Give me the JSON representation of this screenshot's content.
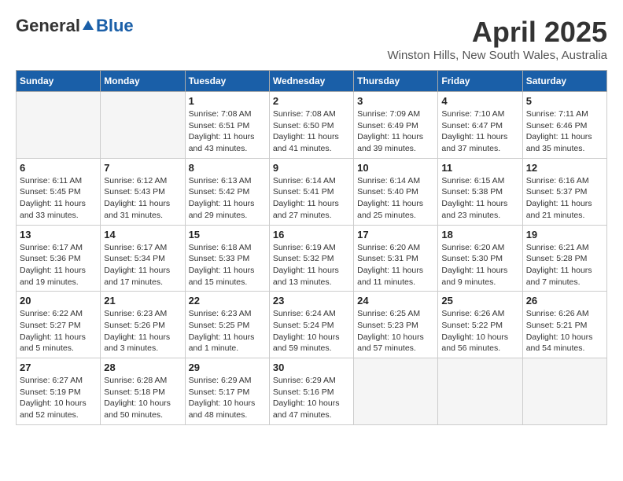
{
  "logo": {
    "general": "General",
    "blue": "Blue"
  },
  "title": "April 2025",
  "subtitle": "Winston Hills, New South Wales, Australia",
  "days_of_week": [
    "Sunday",
    "Monday",
    "Tuesday",
    "Wednesday",
    "Thursday",
    "Friday",
    "Saturday"
  ],
  "weeks": [
    [
      {
        "day": "",
        "info": ""
      },
      {
        "day": "",
        "info": ""
      },
      {
        "day": "1",
        "sunrise": "Sunrise: 7:08 AM",
        "sunset": "Sunset: 6:51 PM",
        "daylight": "Daylight: 11 hours and 43 minutes."
      },
      {
        "day": "2",
        "sunrise": "Sunrise: 7:08 AM",
        "sunset": "Sunset: 6:50 PM",
        "daylight": "Daylight: 11 hours and 41 minutes."
      },
      {
        "day": "3",
        "sunrise": "Sunrise: 7:09 AM",
        "sunset": "Sunset: 6:49 PM",
        "daylight": "Daylight: 11 hours and 39 minutes."
      },
      {
        "day": "4",
        "sunrise": "Sunrise: 7:10 AM",
        "sunset": "Sunset: 6:47 PM",
        "daylight": "Daylight: 11 hours and 37 minutes."
      },
      {
        "day": "5",
        "sunrise": "Sunrise: 7:11 AM",
        "sunset": "Sunset: 6:46 PM",
        "daylight": "Daylight: 11 hours and 35 minutes."
      }
    ],
    [
      {
        "day": "6",
        "sunrise": "Sunrise: 6:11 AM",
        "sunset": "Sunset: 5:45 PM",
        "daylight": "Daylight: 11 hours and 33 minutes."
      },
      {
        "day": "7",
        "sunrise": "Sunrise: 6:12 AM",
        "sunset": "Sunset: 5:43 PM",
        "daylight": "Daylight: 11 hours and 31 minutes."
      },
      {
        "day": "8",
        "sunrise": "Sunrise: 6:13 AM",
        "sunset": "Sunset: 5:42 PM",
        "daylight": "Daylight: 11 hours and 29 minutes."
      },
      {
        "day": "9",
        "sunrise": "Sunrise: 6:14 AM",
        "sunset": "Sunset: 5:41 PM",
        "daylight": "Daylight: 11 hours and 27 minutes."
      },
      {
        "day": "10",
        "sunrise": "Sunrise: 6:14 AM",
        "sunset": "Sunset: 5:40 PM",
        "daylight": "Daylight: 11 hours and 25 minutes."
      },
      {
        "day": "11",
        "sunrise": "Sunrise: 6:15 AM",
        "sunset": "Sunset: 5:38 PM",
        "daylight": "Daylight: 11 hours and 23 minutes."
      },
      {
        "day": "12",
        "sunrise": "Sunrise: 6:16 AM",
        "sunset": "Sunset: 5:37 PM",
        "daylight": "Daylight: 11 hours and 21 minutes."
      }
    ],
    [
      {
        "day": "13",
        "sunrise": "Sunrise: 6:17 AM",
        "sunset": "Sunset: 5:36 PM",
        "daylight": "Daylight: 11 hours and 19 minutes."
      },
      {
        "day": "14",
        "sunrise": "Sunrise: 6:17 AM",
        "sunset": "Sunset: 5:34 PM",
        "daylight": "Daylight: 11 hours and 17 minutes."
      },
      {
        "day": "15",
        "sunrise": "Sunrise: 6:18 AM",
        "sunset": "Sunset: 5:33 PM",
        "daylight": "Daylight: 11 hours and 15 minutes."
      },
      {
        "day": "16",
        "sunrise": "Sunrise: 6:19 AM",
        "sunset": "Sunset: 5:32 PM",
        "daylight": "Daylight: 11 hours and 13 minutes."
      },
      {
        "day": "17",
        "sunrise": "Sunrise: 6:20 AM",
        "sunset": "Sunset: 5:31 PM",
        "daylight": "Daylight: 11 hours and 11 minutes."
      },
      {
        "day": "18",
        "sunrise": "Sunrise: 6:20 AM",
        "sunset": "Sunset: 5:30 PM",
        "daylight": "Daylight: 11 hours and 9 minutes."
      },
      {
        "day": "19",
        "sunrise": "Sunrise: 6:21 AM",
        "sunset": "Sunset: 5:28 PM",
        "daylight": "Daylight: 11 hours and 7 minutes."
      }
    ],
    [
      {
        "day": "20",
        "sunrise": "Sunrise: 6:22 AM",
        "sunset": "Sunset: 5:27 PM",
        "daylight": "Daylight: 11 hours and 5 minutes."
      },
      {
        "day": "21",
        "sunrise": "Sunrise: 6:23 AM",
        "sunset": "Sunset: 5:26 PM",
        "daylight": "Daylight: 11 hours and 3 minutes."
      },
      {
        "day": "22",
        "sunrise": "Sunrise: 6:23 AM",
        "sunset": "Sunset: 5:25 PM",
        "daylight": "Daylight: 11 hours and 1 minute."
      },
      {
        "day": "23",
        "sunrise": "Sunrise: 6:24 AM",
        "sunset": "Sunset: 5:24 PM",
        "daylight": "Daylight: 10 hours and 59 minutes."
      },
      {
        "day": "24",
        "sunrise": "Sunrise: 6:25 AM",
        "sunset": "Sunset: 5:23 PM",
        "daylight": "Daylight: 10 hours and 57 minutes."
      },
      {
        "day": "25",
        "sunrise": "Sunrise: 6:26 AM",
        "sunset": "Sunset: 5:22 PM",
        "daylight": "Daylight: 10 hours and 56 minutes."
      },
      {
        "day": "26",
        "sunrise": "Sunrise: 6:26 AM",
        "sunset": "Sunset: 5:21 PM",
        "daylight": "Daylight: 10 hours and 54 minutes."
      }
    ],
    [
      {
        "day": "27",
        "sunrise": "Sunrise: 6:27 AM",
        "sunset": "Sunset: 5:19 PM",
        "daylight": "Daylight: 10 hours and 52 minutes."
      },
      {
        "day": "28",
        "sunrise": "Sunrise: 6:28 AM",
        "sunset": "Sunset: 5:18 PM",
        "daylight": "Daylight: 10 hours and 50 minutes."
      },
      {
        "day": "29",
        "sunrise": "Sunrise: 6:29 AM",
        "sunset": "Sunset: 5:17 PM",
        "daylight": "Daylight: 10 hours and 48 minutes."
      },
      {
        "day": "30",
        "sunrise": "Sunrise: 6:29 AM",
        "sunset": "Sunset: 5:16 PM",
        "daylight": "Daylight: 10 hours and 47 minutes."
      },
      {
        "day": "",
        "info": ""
      },
      {
        "day": "",
        "info": ""
      },
      {
        "day": "",
        "info": ""
      }
    ]
  ]
}
